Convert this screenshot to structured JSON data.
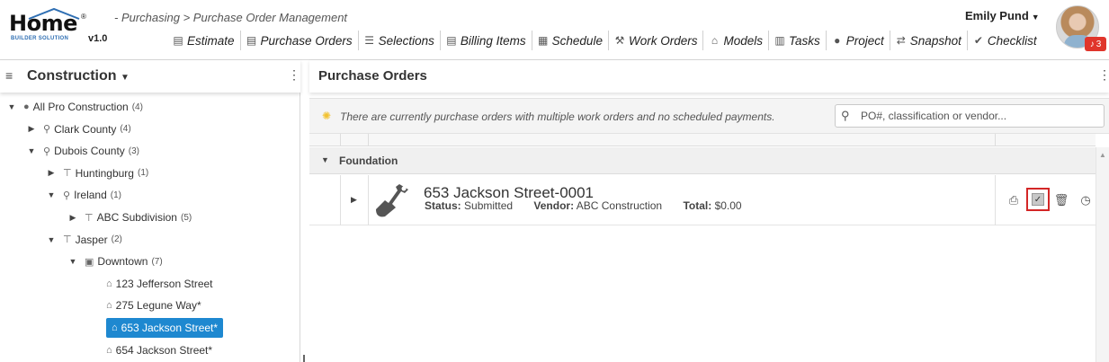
{
  "brand": {
    "logo_text": "Home",
    "logo_sub": "BUILDER SOLUTION",
    "version": "v1.0",
    "reg": "®"
  },
  "breadcrumb": "- Purchasing > Purchase Order Management",
  "nav": [
    {
      "label": "Estimate",
      "icon": "document-icon",
      "glyph": "▤"
    },
    {
      "label": "Purchase Orders",
      "icon": "list-doc-icon",
      "glyph": "▤"
    },
    {
      "label": "Selections",
      "icon": "checklist-icon",
      "glyph": "☰"
    },
    {
      "label": "Billing Items",
      "icon": "receipt-icon",
      "glyph": "▤"
    },
    {
      "label": "Schedule",
      "icon": "calendar-icon",
      "glyph": "▦"
    },
    {
      "label": "Work Orders",
      "icon": "workers-icon",
      "glyph": "⚒"
    },
    {
      "label": "Models",
      "icon": "house-icon",
      "glyph": "⌂"
    },
    {
      "label": "Tasks",
      "icon": "clipboard-icon",
      "glyph": "▥"
    },
    {
      "label": "Project",
      "icon": "person-icon",
      "glyph": "●"
    },
    {
      "label": "Snapshot",
      "icon": "shuffle-icon",
      "glyph": "⇄"
    },
    {
      "label": "Checklist",
      "icon": "check-icon",
      "glyph": "✔"
    }
  ],
  "user": {
    "name": "Emily Pund",
    "notifications": "3"
  },
  "sidebar": {
    "title": "Construction",
    "tree": [
      {
        "label": "All Pro Construction",
        "count": "(4)",
        "toggle": "▼",
        "icon": "person-icon",
        "glyph": "●",
        "selected": false
      },
      {
        "label": "Clark County",
        "count": "(4)",
        "toggle": "▶",
        "icon": "map-pin-icon",
        "glyph": "⚲",
        "selected": false
      },
      {
        "label": "Dubois County",
        "count": "(3)",
        "toggle": "▼",
        "icon": "map-pin-icon",
        "glyph": "⚲",
        "selected": false
      },
      {
        "label": "Huntingburg",
        "count": "(1)",
        "toggle": "▶",
        "icon": "signpost-icon",
        "glyph": "⊤",
        "selected": false
      },
      {
        "label": "Ireland",
        "count": "(1)",
        "toggle": "▼",
        "icon": "map-pin-icon",
        "glyph": "⚲",
        "selected": false
      },
      {
        "label": "ABC Subdivision",
        "count": "(5)",
        "toggle": "▶",
        "icon": "signpost-icon",
        "glyph": "⊤",
        "selected": false
      },
      {
        "label": "Jasper",
        "count": "(2)",
        "toggle": "▼",
        "icon": "signpost-icon",
        "glyph": "⊤",
        "selected": false
      },
      {
        "label": "Downtown",
        "count": "(7)",
        "toggle": "▼",
        "icon": "map-icon",
        "glyph": "▣",
        "selected": false
      },
      {
        "label": "123 Jefferson Street",
        "count": "",
        "toggle": "",
        "icon": "house-icon",
        "glyph": "⌂",
        "selected": false
      },
      {
        "label": "275 Legune Way*",
        "count": "",
        "toggle": "",
        "icon": "house-icon",
        "glyph": "⌂",
        "selected": false
      },
      {
        "label": "653 Jackson Street*",
        "count": "",
        "toggle": "",
        "icon": "house-icon",
        "glyph": "⌂",
        "selected": true
      },
      {
        "label": "654 Jackson Street*",
        "count": "",
        "toggle": "",
        "icon": "house-icon",
        "glyph": "⌂",
        "selected": false
      }
    ]
  },
  "main": {
    "title": "Purchase Orders",
    "info_message": "There are currently purchase orders with multiple work orders and no scheduled payments.",
    "search_placeholder": "PO#, classification or vendor...",
    "search_value": "",
    "group": "Foundation",
    "po": {
      "title": "653 Jackson Street-0001",
      "status_label": "Status:",
      "status": "Submitted",
      "vendor_label": "Vendor:",
      "vendor": "ABC Construction",
      "total_label": "Total:",
      "total": "$0.00"
    }
  },
  "colors": {
    "selected": "#1e88d0",
    "highlight": "#d32626",
    "notif": "#e0352b"
  }
}
